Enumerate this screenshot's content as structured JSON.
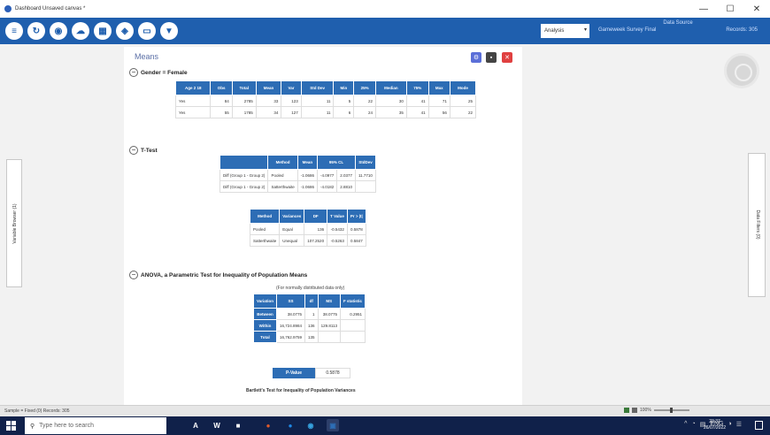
{
  "window": {
    "title": "Dashboard Unsaved canvas *",
    "controls": [
      "—",
      "☐",
      "✕"
    ]
  },
  "toolbar": {
    "icons": [
      "list-icon",
      "refresh-icon",
      "stats-icon",
      "cloud-icon",
      "grid-icon",
      "chart-icon",
      "monitor-icon",
      "filter-icon"
    ],
    "glyphs": [
      "≡",
      "↻",
      "◉",
      "☁",
      "▦",
      "◈",
      "▭",
      "▼"
    ],
    "analysis_select": "Analysis",
    "data_source": {
      "header": "Data Source",
      "source": "Gameweek Survey Final",
      "rows": "Records: 305"
    }
  },
  "left_panel": {
    "label": "Variable Browser (1)"
  },
  "right_panel": {
    "label": "Data Filters (0)"
  },
  "panel": {
    "title": "Means",
    "section_gender": "Gender = Female",
    "gender_table": {
      "headers": [
        "Age 2 18",
        "Obs",
        "Total",
        "Mean",
        "Var",
        "Std Dev",
        "Min",
        "25%",
        "Median",
        "75%",
        "Max",
        "Mode"
      ],
      "rows": [
        [
          "Yes",
          "84",
          "2785",
          "33",
          "123",
          "11",
          "5",
          "22",
          "30",
          "41",
          "71",
          "25"
        ],
        [
          "Yes",
          "55",
          "1785",
          "34",
          "127",
          "11",
          "6",
          "24",
          "35",
          "41",
          "56",
          "22"
        ]
      ]
    },
    "section_ttest": "T-Test",
    "ttest_table": {
      "headers": [
        "",
        "Method",
        "Mean",
        "95% CL",
        "StdDev"
      ],
      "rows": [
        [
          "Diff (Group 1 - Group 2)",
          "Pooled",
          "-1.0686",
          "-4.0977",
          "2.0377",
          "11.7710"
        ],
        [
          "Diff (Group 1 - Group 2)",
          "Satterthwaite",
          "-1.0686",
          "-4.0182",
          "2.8810",
          ""
        ]
      ]
    },
    "ttest_table2": {
      "headers": [
        "Method",
        "Variances",
        "DF",
        "T Value",
        "Pr > |t|"
      ],
      "rows": [
        [
          "Pooled",
          "Equal",
          "136",
          "-0.5432",
          "0.5878"
        ],
        [
          "Satterthwaite",
          "Unequal",
          "107.2520",
          "-0.5263",
          "0.5847"
        ]
      ]
    },
    "section_anova": "ANOVA, a Parametric Test for Inequality of Population Means",
    "anova_note": "(For normally distributed data only)",
    "anova_table": {
      "headers": [
        "Variation",
        "SS",
        "df",
        "MS",
        "F statistic"
      ],
      "rows": [
        [
          "Between",
          "38.0775",
          "1",
          "38.0775",
          "0.2951"
        ],
        [
          "Within",
          "16,724.8984",
          "136",
          "129.8113",
          ""
        ],
        [
          "Total",
          "16,762.9759",
          "135",
          "",
          ""
        ]
      ]
    },
    "pvalue": {
      "label": "P-Value",
      "value": "0.5878"
    },
    "bartlett": "Bartlett's Test for Inequality of Population Variances"
  },
  "statusbar": {
    "text": "Sample = Fixed (0) Records: 305",
    "zoom": "100%"
  },
  "taskbar": {
    "search_placeholder": "Type here to search",
    "apps": [
      "A",
      "W",
      "■",
      "●",
      "●",
      "◉",
      "▣"
    ],
    "app_colors": [
      "#2b2b2b",
      "#2b2b2b",
      "#3c6fd8",
      "#e05a2a",
      "#1e88e5",
      "#36a3e0",
      "#2d6db5"
    ],
    "tray": [
      "^",
      "◔",
      "▤",
      "ENG",
      "◑",
      "☰"
    ],
    "time": "23:37",
    "date": "26/07/2022"
  },
  "colors": {
    "toolbar": "#1f5fae",
    "table_header": "#2d6db5",
    "taskbar": "#10214a"
  }
}
